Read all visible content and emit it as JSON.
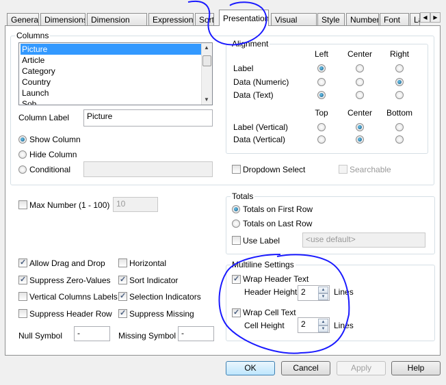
{
  "tabs": [
    "General",
    "Dimensions",
    "Dimension Limits",
    "Expressions",
    "Sort",
    "Presentation",
    "Visual Cues",
    "Style",
    "Number",
    "Font",
    "La"
  ],
  "selected_tab": "Presentation",
  "columns": {
    "title": "Columns",
    "items": [
      "Picture",
      "Article",
      "Category",
      "Country",
      "Launch",
      "Sob"
    ],
    "selected": "Picture",
    "column_label": "Column Label",
    "column_label_value": "Picture",
    "show_column": "Show Column",
    "hide_column": "Hide Column",
    "conditional": "Conditional",
    "visibility": "Show Column"
  },
  "alignment": {
    "title": "Alignment",
    "h_headers": [
      "Left",
      "Center",
      "Right"
    ],
    "h_rows": [
      {
        "label": "Label",
        "value": "Left"
      },
      {
        "label": "Data (Numeric)",
        "value": "Right"
      },
      {
        "label": "Data (Text)",
        "value": "Left"
      }
    ],
    "v_headers": [
      "Top",
      "Center",
      "Bottom"
    ],
    "v_rows": [
      {
        "label": "Label (Vertical)",
        "value": "Center"
      },
      {
        "label": "Data (Vertical)",
        "value": "Center"
      }
    ]
  },
  "dropdown_select": {
    "label": "Dropdown Select",
    "checked": false
  },
  "searchable": {
    "label": "Searchable",
    "checked": false,
    "disabled": true
  },
  "max_number": {
    "label": "Max Number (1 - 100)",
    "checked": false,
    "value": "10"
  },
  "totals": {
    "title": "Totals",
    "first": "Totals on First Row",
    "last": "Totals on Last Row",
    "selected": "first",
    "use_label": "Use Label",
    "use_label_checked": false,
    "label_placeholder": "<use default>"
  },
  "options": [
    {
      "label": "Allow Drag and Drop",
      "checked": true
    },
    {
      "label": "Horizontal",
      "checked": false
    },
    {
      "label": "Suppress Zero-Values",
      "checked": true
    },
    {
      "label": "Sort Indicator",
      "checked": true
    },
    {
      "label": "Vertical Columns Labels",
      "checked": false
    },
    {
      "label": "Selection Indicators",
      "checked": true
    },
    {
      "label": "Suppress Header Row",
      "checked": false
    },
    {
      "label": "Suppress Missing",
      "checked": true
    }
  ],
  "null_symbol": {
    "label": "Null Symbol",
    "value": "-"
  },
  "missing_symbol": {
    "label": "Missing Symbol",
    "value": "-"
  },
  "multiline": {
    "title": "Multiline Settings",
    "wrap_header": "Wrap Header Text",
    "wrap_header_checked": true,
    "header_height": "Header Height",
    "header_value": "2",
    "wrap_cell": "Wrap Cell Text",
    "wrap_cell_checked": true,
    "cell_height": "Cell Height",
    "cell_value": "2",
    "lines": "Lines"
  },
  "buttons": {
    "ok": "OK",
    "cancel": "Cancel",
    "apply": "Apply",
    "help": "Help"
  },
  "annotation_color": "#1a1aff"
}
